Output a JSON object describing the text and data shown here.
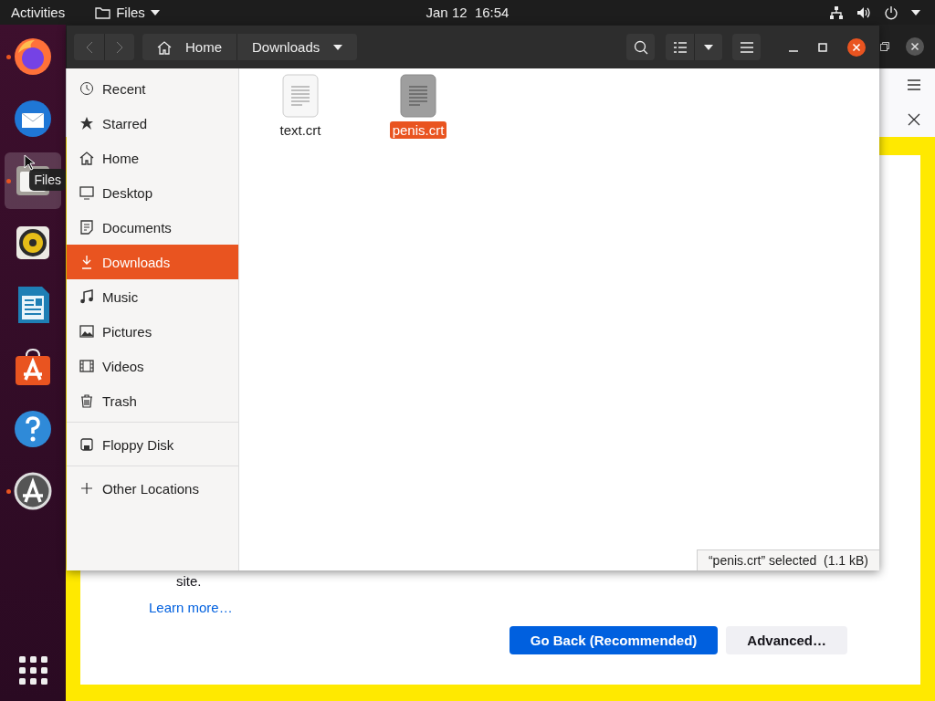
{
  "top_bar": {
    "activities": "Activities",
    "app_menu": "Files",
    "clock": "Jan 12  16:54"
  },
  "dock": {
    "apps": [
      {
        "kind": "browser",
        "running": true,
        "focused": false
      },
      {
        "kind": "mail",
        "running": false,
        "focused": false
      },
      {
        "kind": "files",
        "running": true,
        "focused": true
      },
      {
        "kind": "music",
        "running": false,
        "focused": false
      },
      {
        "kind": "writer",
        "running": false,
        "focused": false
      },
      {
        "kind": "store",
        "running": false,
        "focused": false
      },
      {
        "kind": "help",
        "running": false,
        "focused": false
      },
      {
        "kind": "updater",
        "running": true,
        "focused": false
      }
    ]
  },
  "tooltip": "Files",
  "files_window": {
    "path": [
      {
        "label": "Home",
        "kind": "home"
      },
      {
        "label": "Downloads",
        "kind": "current"
      }
    ],
    "sidebar": {
      "sections": [
        [
          {
            "label": "Recent",
            "kind": "recent",
            "selected": false
          },
          {
            "label": "Starred",
            "kind": "starred",
            "selected": false
          },
          {
            "label": "Home",
            "kind": "home",
            "selected": false
          },
          {
            "label": "Desktop",
            "kind": "desktop",
            "selected": false
          },
          {
            "label": "Documents",
            "kind": "documents",
            "selected": false
          },
          {
            "label": "Downloads",
            "kind": "downloads",
            "selected": true
          },
          {
            "label": "Music",
            "kind": "music",
            "selected": false
          },
          {
            "label": "Pictures",
            "kind": "pictures",
            "selected": false
          },
          {
            "label": "Videos",
            "kind": "videos",
            "selected": false
          },
          {
            "label": "Trash",
            "kind": "trash",
            "selected": false
          }
        ],
        [
          {
            "label": "Floppy Disk",
            "kind": "floppy",
            "selected": false
          }
        ],
        [
          {
            "label": "Other Locations",
            "kind": "other",
            "selected": false
          }
        ]
      ]
    },
    "files": [
      {
        "name": "text.crt",
        "selected": false
      },
      {
        "name": "penis.crt",
        "selected": true
      }
    ],
    "status": "“penis.crt” selected  (1.1 kB)"
  },
  "browser": {
    "partial_text": "site.",
    "link": "Learn more…",
    "buttons": [
      {
        "label": "Go Back (Recommended)",
        "kind": "primary"
      },
      {
        "label": "Advanced…",
        "kind": "secondary"
      }
    ]
  }
}
